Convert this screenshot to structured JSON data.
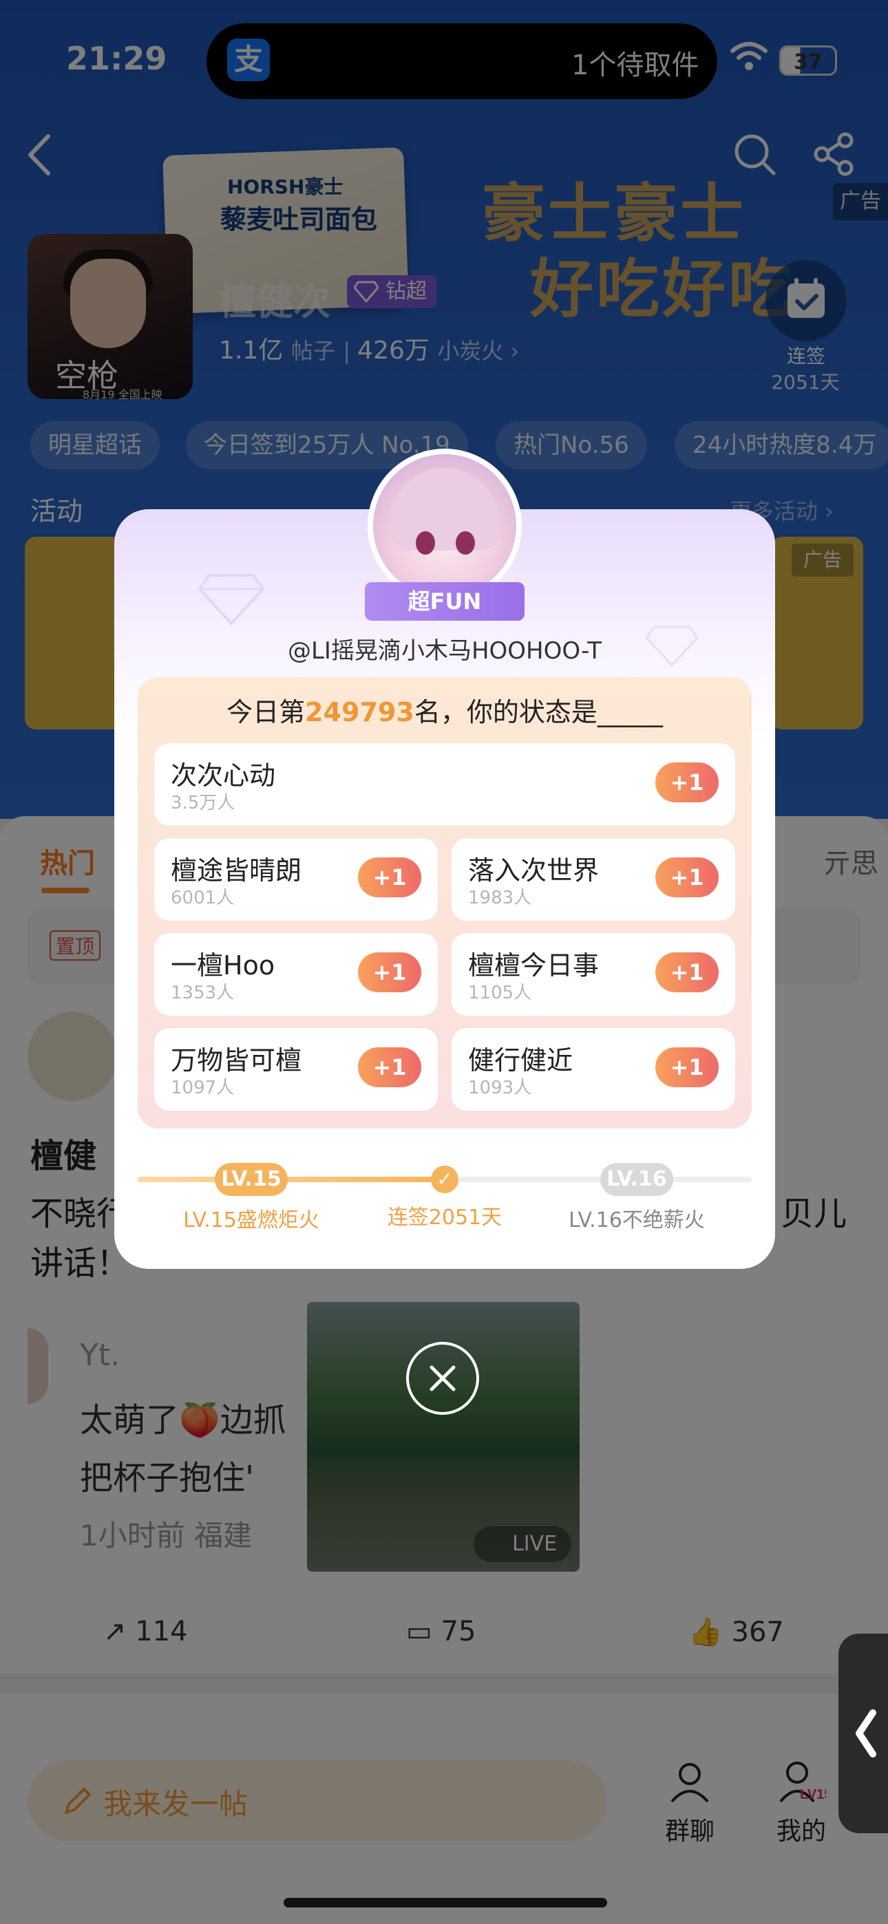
{
  "status_bar": {
    "time": "21:29",
    "app_icon_char": "支",
    "notification": "1个待取件",
    "battery": "37"
  },
  "header": {
    "ad_tag": "广告"
  },
  "banner": {
    "brand": "HORSH豪士",
    "product": "藜麦吐司面包",
    "slogan_line1": "豪士豪士",
    "slogan_line2": "好吃好吃"
  },
  "profile": {
    "avatar_caption": "空枪",
    "avatar_date": "8月19 全国上映",
    "name": "檀健次",
    "badge": "钻超",
    "posts_count": "1.1亿",
    "posts_label": "帖子",
    "fans_count": "426万",
    "fans_label": "小炭火 ›",
    "checkin_label": "连签",
    "checkin_days": "2051天"
  },
  "tags": [
    "明星超话",
    "今日签到25万人 No.19",
    "热门No.56",
    "24小时热度8.4万"
  ],
  "activity": {
    "label": "活动",
    "more": "更多活动 ›",
    "ad_tag": "广告"
  },
  "tabs": {
    "hot": "热门",
    "right1": "",
    "right2": "亓思"
  },
  "pinned": {
    "tag": "置顶"
  },
  "post": {
    "title_fragment": "檀健",
    "body_line1_left": "不晓行",
    "body_line1_right": "贝儿",
    "body_line2": "讲话！",
    "comment_name": "Yt.",
    "comment_line1": "太萌了🍑边抓",
    "comment_line2": "把杯子抱住'",
    "comment_meta": "1小时前 福建",
    "live_label": "LIVE",
    "shares": "114",
    "comments": "75",
    "likes": "367"
  },
  "bottom": {
    "compose": "我来发一帖",
    "group_chat": "群聊",
    "mine": "我的",
    "mine_level": "LV15"
  },
  "popup": {
    "badge": "超FUN",
    "username": "@LI摇晃滴小木马HOOHOO-T",
    "rank_prefix": "今日第",
    "rank_number": "249793",
    "rank_suffix": "名，你的状态是_____",
    "plus_label": "+1",
    "options": [
      {
        "title": "次次心动",
        "count": "3.5万人"
      },
      {
        "title": "檀途皆晴朗",
        "count": "6001人"
      },
      {
        "title": "落入次世界",
        "count": "1983人"
      },
      {
        "title": "一檀Hoo",
        "count": "1353人"
      },
      {
        "title": "檀檀今日事",
        "count": "1105人"
      },
      {
        "title": "万物皆可檀",
        "count": "1097人"
      },
      {
        "title": "健行健近",
        "count": "1093人"
      }
    ],
    "level_current": "LV.15",
    "level_next": "LV.16",
    "level_current_label": "LV.15盛燃炬火",
    "streak_label": "连签2051天",
    "level_next_label": "LV.16不绝薪火",
    "progress": 0.5
  }
}
